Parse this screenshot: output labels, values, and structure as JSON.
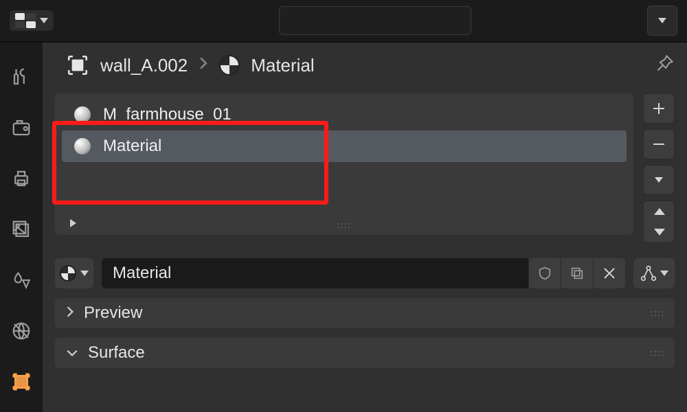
{
  "search": {
    "value": ""
  },
  "breadcrumb": {
    "object_name": "wall_A.002",
    "material_name": "Material"
  },
  "material_slots": [
    {
      "name": "M_farmhouse_01",
      "selected": false
    },
    {
      "name": "Material",
      "selected": true
    }
  ],
  "material_name_field": {
    "value": "Material"
  },
  "sections": {
    "preview": {
      "title": "Preview",
      "open": false
    },
    "surface": {
      "title": "Surface",
      "open": true
    }
  }
}
